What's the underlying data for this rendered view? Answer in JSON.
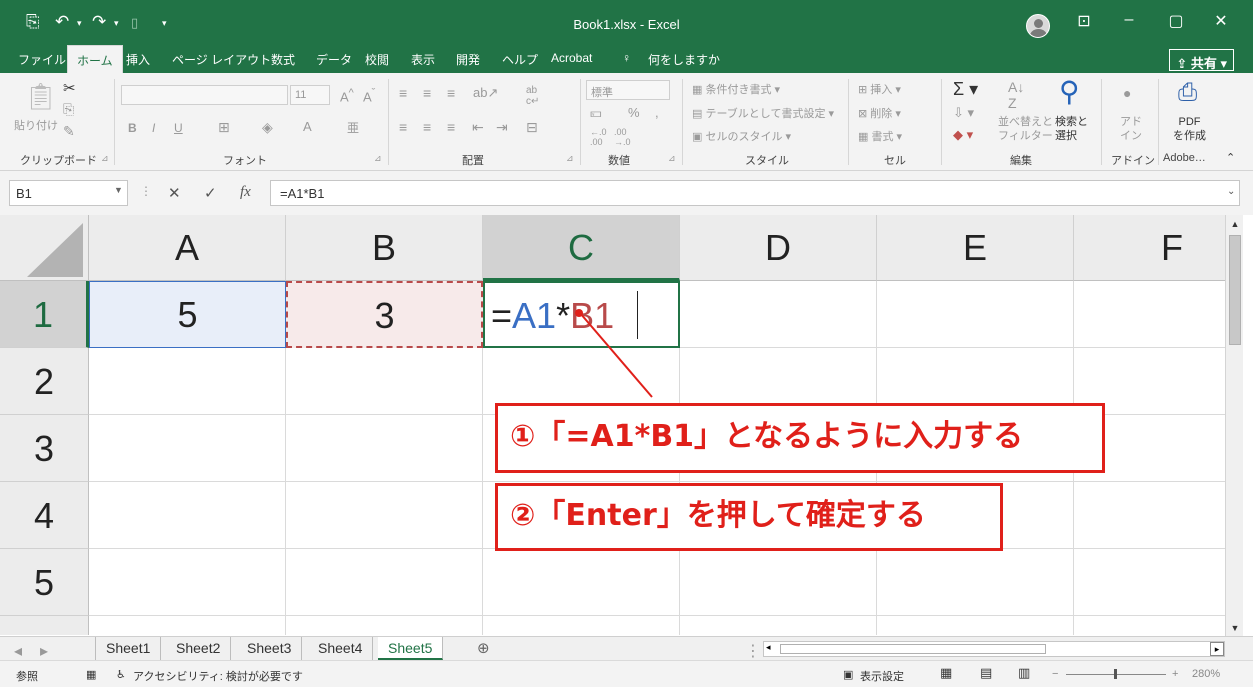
{
  "window": {
    "title": "Book1.xlsx  -  Excel",
    "minimize": "–",
    "maximize": "▢",
    "close": "✕",
    "ribbon_display": "⊡"
  },
  "tabs": [
    "ファイル",
    "ホーム",
    "挿入",
    "ページ レイアウト",
    "数式",
    "データ",
    "校閲",
    "表示",
    "開発",
    "ヘルプ",
    "Acrobat",
    "何をしますか"
  ],
  "share_label": "共有",
  "ribbon": {
    "groups": [
      "クリップボード",
      "フォント",
      "配置",
      "数値",
      "スタイル",
      "セル",
      "編集",
      "アドイン",
      "Adobe…"
    ],
    "paste_label": "貼り付け",
    "font_size": "11",
    "number_format": "標準",
    "style_items": [
      "条件付き書式",
      "テーブルとして書式設定",
      "セルのスタイル"
    ],
    "cell_items": [
      "挿入",
      "削除",
      "書式"
    ],
    "edit_items": [
      "並べ替えと\nフィルター",
      "検索と\n選択"
    ],
    "addin_label": "アド\nイン",
    "pdf_label": "PDF\nを作成"
  },
  "formula_bar": {
    "name_box": "B1",
    "formula": "=A1*B1",
    "fx": "fx"
  },
  "columns": [
    "A",
    "B",
    "C",
    "D",
    "E",
    "F"
  ],
  "rows": [
    "1",
    "2",
    "3",
    "4",
    "5"
  ],
  "cells": {
    "A1": "5",
    "B1": "3",
    "C1_eq": "=",
    "C1_ref1": "A1",
    "C1_op": "*",
    "C1_ref2": "B1"
  },
  "callouts": {
    "step1": "①「=A1*B1」となるように入力する",
    "step2": "②「Enter」を押して確定する"
  },
  "sheets": [
    "Sheet1",
    "Sheet2",
    "Sheet3",
    "Sheet4",
    "Sheet5"
  ],
  "active_sheet": "Sheet5",
  "status": {
    "mode": "参照",
    "accessibility": "アクセシビリティ: 検討が必要です",
    "display_settings": "表示設定",
    "zoom": "280%"
  },
  "colors": {
    "excel_green": "#217346",
    "callout_red": "#e0201a",
    "ref_blue": "#3a6fc4",
    "ref_red": "#b84a4a",
    "a1_fill": "#e8eef9",
    "b1_fill": "#f7eaea"
  }
}
